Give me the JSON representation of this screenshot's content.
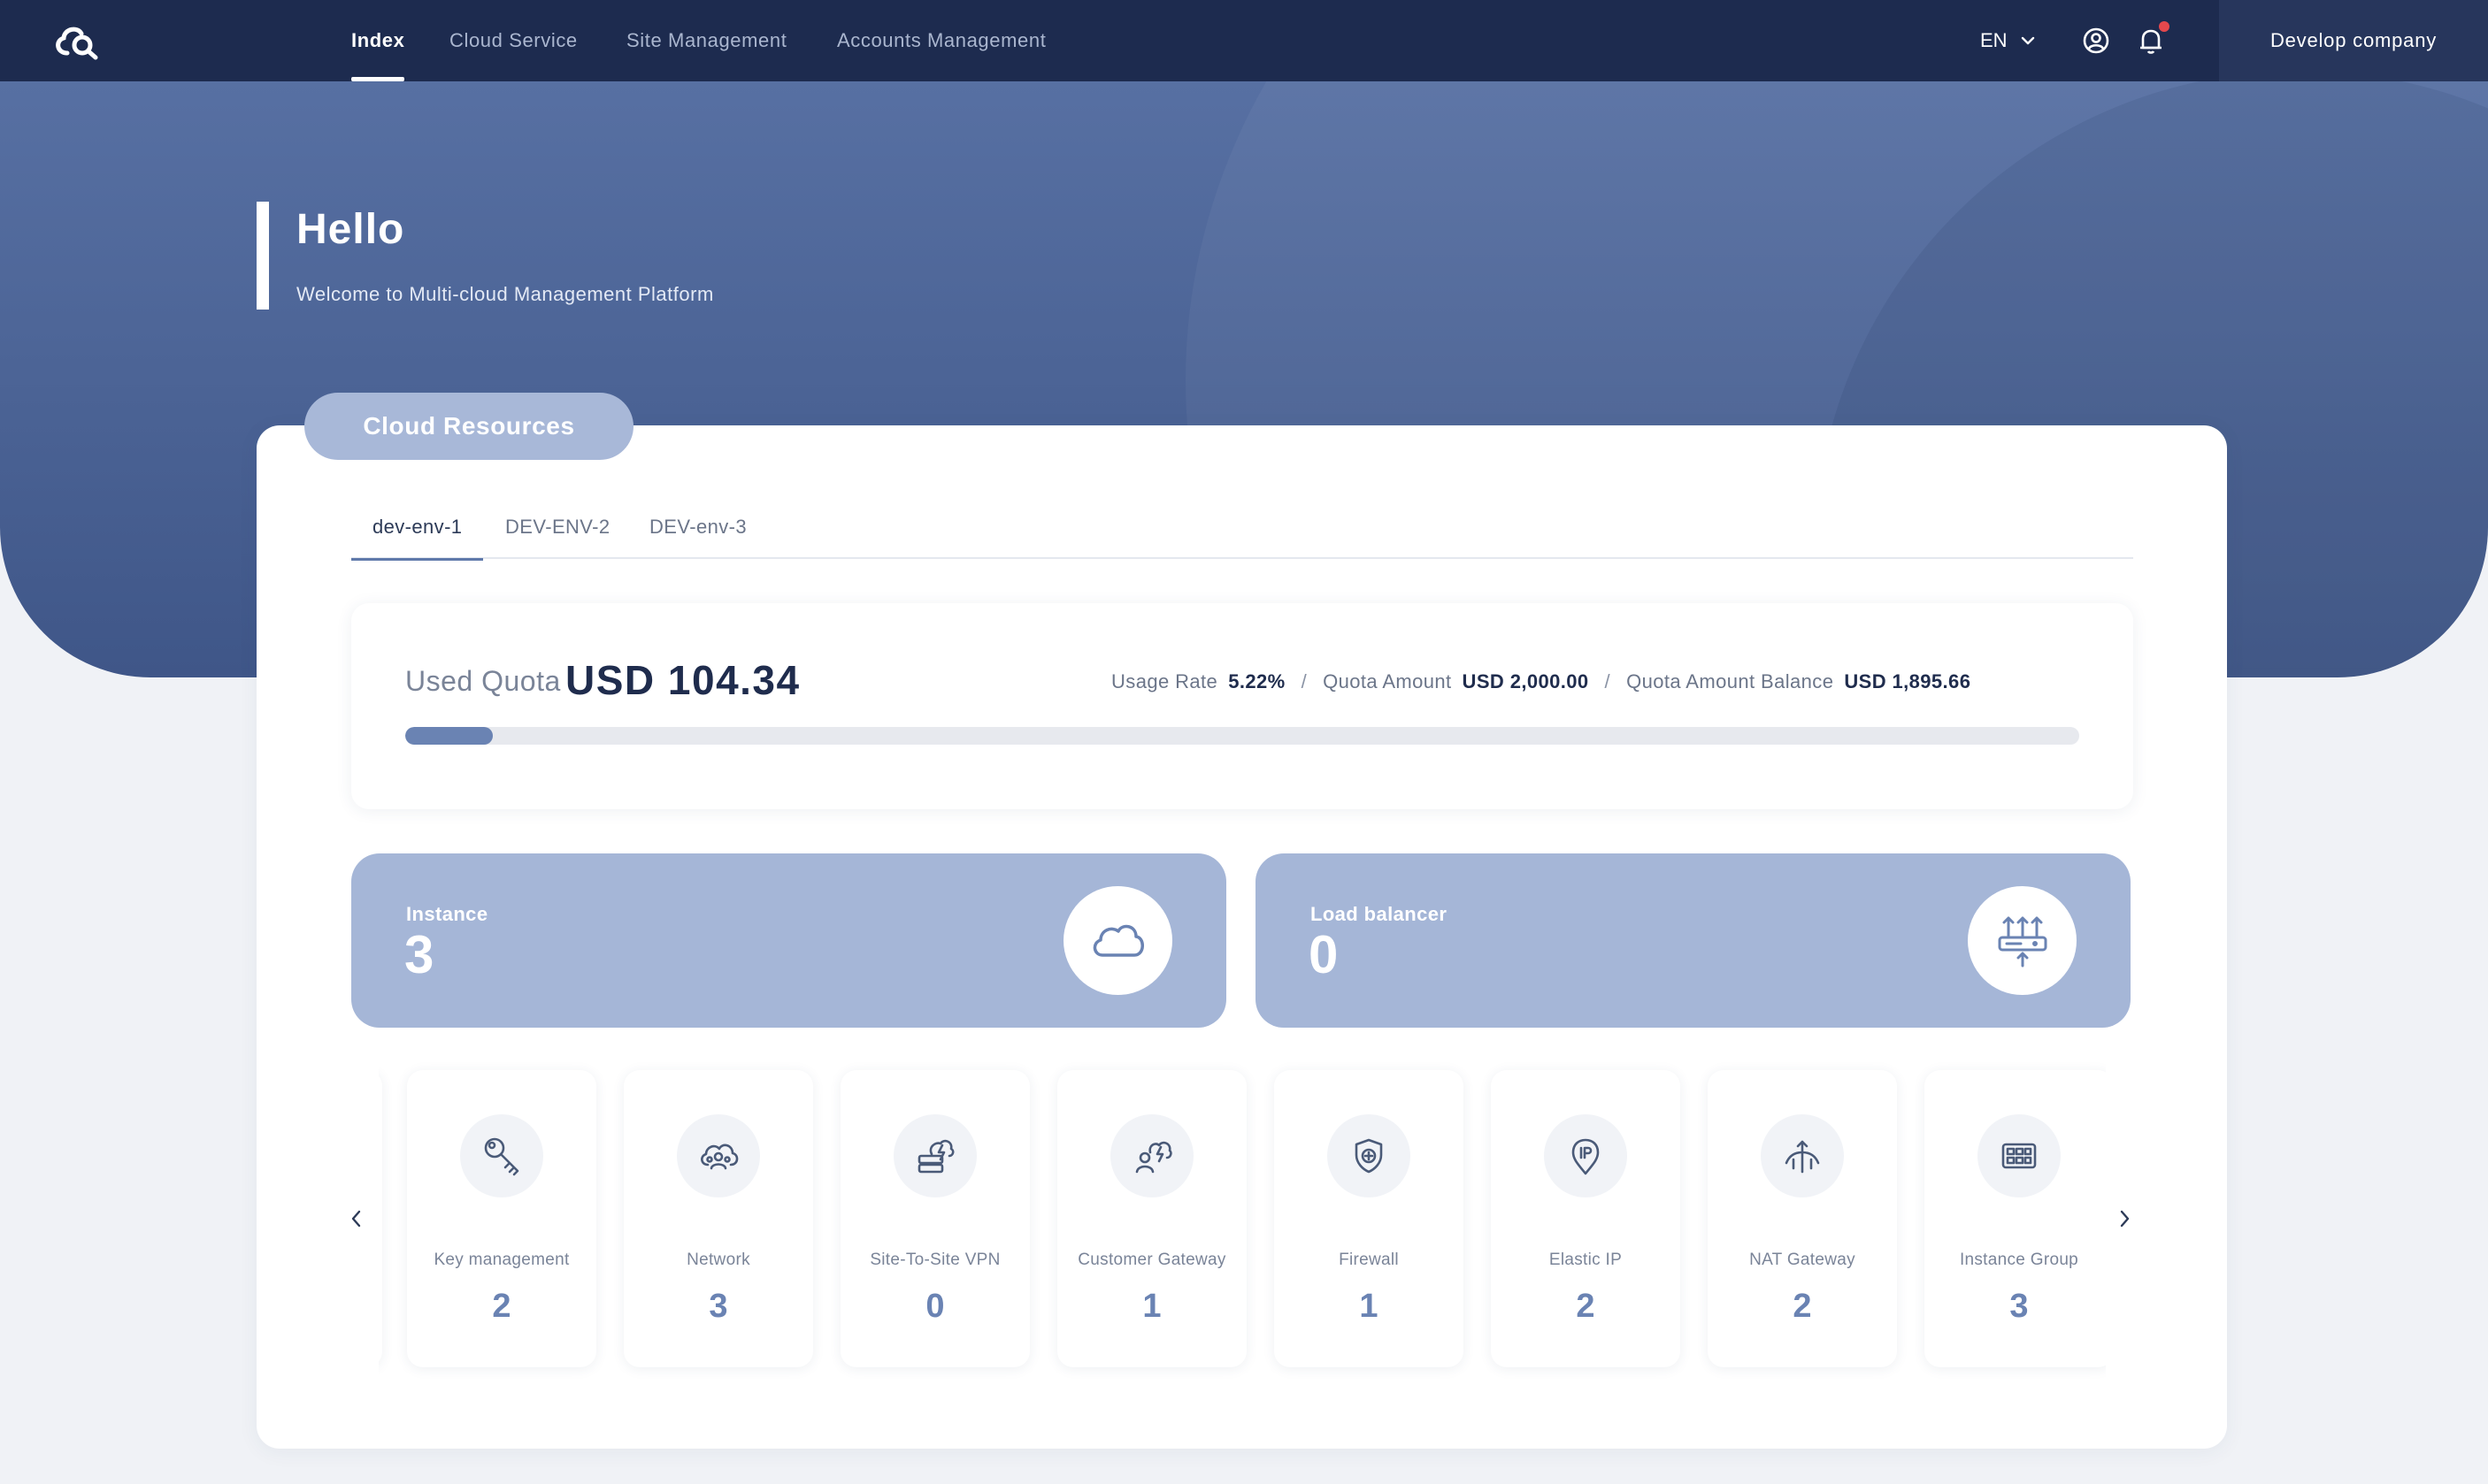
{
  "nav": {
    "items": [
      {
        "label": "Index",
        "active": true
      },
      {
        "label": "Cloud Service",
        "active": false
      },
      {
        "label": "Site Management",
        "active": false
      },
      {
        "label": "Accounts Management",
        "active": false
      }
    ],
    "language": "EN",
    "company": "Develop company",
    "notification_dot": true
  },
  "hero": {
    "title": "Hello",
    "subtitle": "Welcome to Multi-cloud Management Platform"
  },
  "cloud_resources": {
    "section_title": "Cloud Resources",
    "tabs": [
      {
        "label": "dev-env-1",
        "active": true
      },
      {
        "label": "DEV-ENV-2",
        "active": false
      },
      {
        "label": "DEV-env-3",
        "active": false
      }
    ],
    "quota": {
      "used_label": "Used Quota",
      "used_value": "USD 104.34",
      "usage_rate_label": "Usage Rate",
      "usage_rate_value": "5.22%",
      "usage_fraction": 0.0522,
      "quota_amount_label": "Quota Amount",
      "quota_amount_value": "USD 2,000.00",
      "balance_label": "Quota Amount Balance",
      "balance_value": "USD 1,895.66",
      "separator": "/"
    },
    "stats": [
      {
        "label": "Instance",
        "value": "3",
        "icon": "cloud-icon"
      },
      {
        "label": "Load balancer",
        "value": "0",
        "icon": "load-balancer-icon"
      }
    ],
    "resources": [
      {
        "label": "Key management",
        "count": "2",
        "icon": "key-icon"
      },
      {
        "label": "Network",
        "count": "3",
        "icon": "network-cloud-icon"
      },
      {
        "label": "Site-To-Site VPN",
        "count": "0",
        "icon": "vpn-icon"
      },
      {
        "label": "Customer Gateway",
        "count": "1",
        "icon": "customer-gateway-icon"
      },
      {
        "label": "Firewall",
        "count": "1",
        "icon": "firewall-shield-icon"
      },
      {
        "label": "Elastic IP",
        "count": "2",
        "icon": "elastic-ip-icon"
      },
      {
        "label": "NAT Gateway",
        "count": "2",
        "icon": "nat-gateway-icon"
      },
      {
        "label": "Instance Group",
        "count": "3",
        "icon": "instance-group-icon"
      }
    ]
  },
  "colors": {
    "nav_bg": "#1d2b4f",
    "company_bg": "#27365c",
    "hero_bg": "#4c6496",
    "accent": "#6a83b3",
    "stat_card_bg": "#a5b6d7",
    "notification": "#e5484d"
  }
}
